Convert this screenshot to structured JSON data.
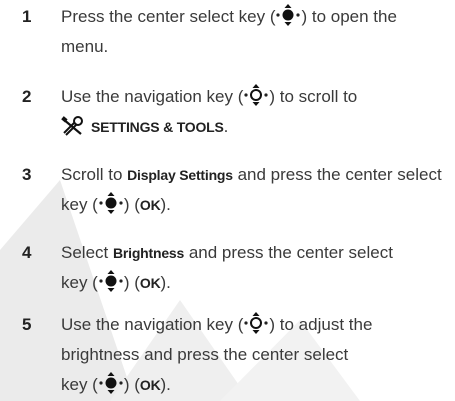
{
  "steps": [
    {
      "number": "1",
      "line1": "Press the center select key (",
      "line1_end": ") to open the",
      "line2": "menu."
    },
    {
      "number": "2",
      "line1": "Use the navigation key (",
      "line1_end": ") to scroll to",
      "line2_keyword": "SETTINGS & TOOLS",
      "line2_end": "."
    },
    {
      "number": "3",
      "line1_start": "Scroll to ",
      "line1_keyword": "Display Settings",
      "line1_end": " and press the center select",
      "line2_start": "key (",
      "line2_mid": ") (",
      "line2_keyword": "OK",
      "line2_end": ")."
    },
    {
      "number": "4",
      "line1_start": "Select ",
      "line1_keyword": "Brightness",
      "line1_end": " and press the center select",
      "line2_start": "key (",
      "line2_mid": ") (",
      "line2_keyword": "OK",
      "line2_end": ")."
    },
    {
      "number": "5",
      "line1": "Use the navigation key (",
      "line1_end": ") to adjust the",
      "line2": "brightness and press the center select",
      "line3_start": "key (",
      "line3_mid": ") (",
      "line3_keyword": "OK",
      "line3_end": ")."
    }
  ],
  "icons": {
    "select_key": "center-select-key-icon",
    "nav_key": "navigation-key-icon",
    "tools": "settings-tools-icon"
  },
  "colors": {
    "text": "#3a3a3a",
    "watermark": "#e6e6e6"
  }
}
